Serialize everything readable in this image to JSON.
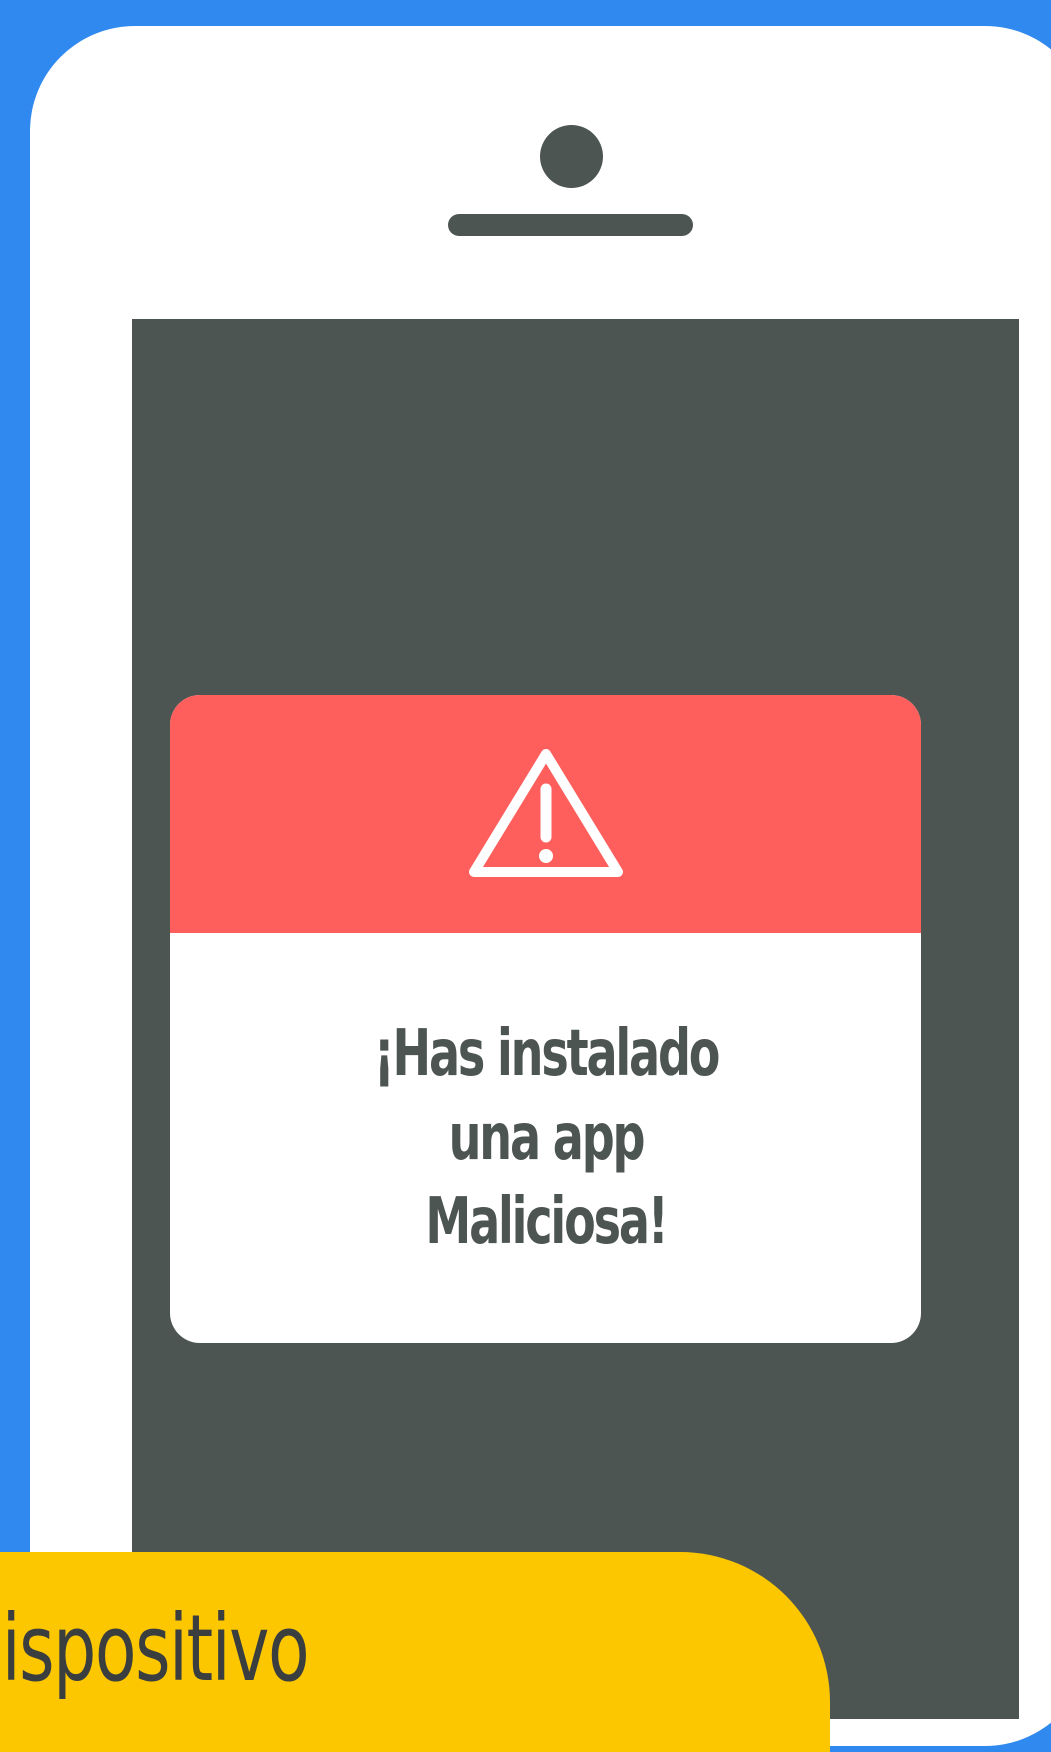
{
  "colors": {
    "background": "#2f89ee",
    "phone_body": "#ffffff",
    "screen": "#4d5553",
    "alert_header": "#fe5f5d",
    "banner": "#fdc700"
  },
  "alert": {
    "icon": "warning-triangle-icon",
    "message": "¡Has instalado una app Maliciosa!"
  },
  "banner": {
    "text": "dispositivo"
  }
}
